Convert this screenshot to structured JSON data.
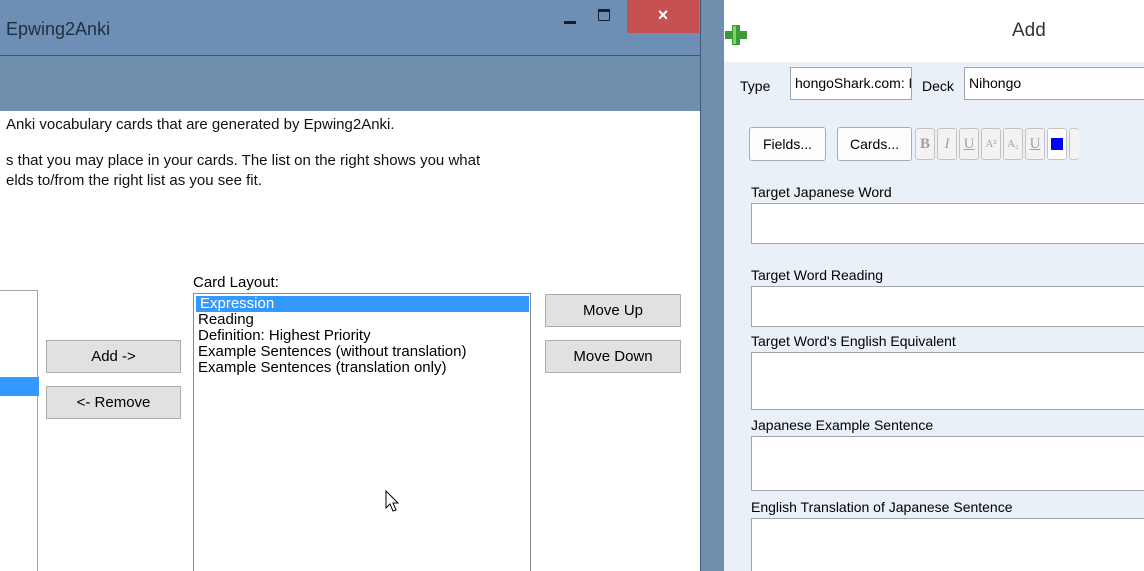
{
  "epwing": {
    "title": "Epwing2Anki",
    "close_glyph": "×",
    "intro_lines": [
      "Anki vocabulary cards that are generated by Epwing2Anki.",
      "s that you may place in your cards. The list on the right shows you what",
      "elds to/from the right list as you see fit."
    ],
    "add_button": "Add ->",
    "remove_button": "<- Remove",
    "card_layout_label": "Card Layout:",
    "card_items": [
      "Expression",
      "Reading",
      "Definition: Highest Priority",
      "Example Sentences (without translation)",
      "Example Sentences (translation only)"
    ],
    "move_up": "Move Up",
    "move_down": "Move Down"
  },
  "anki_add": {
    "title": "Add",
    "type_label": "Type",
    "type_value": "hongoShark.com: My Vocabular",
    "deck_label": "Deck",
    "deck_value": "Nihongo",
    "fields_button": "Fields...",
    "cards_button": "Cards...",
    "format_buttons": [
      "B",
      "I",
      "U",
      "A²",
      "A₂",
      "U"
    ],
    "color_swatch": "#0000ff",
    "fields": [
      "Target Japanese Word",
      "Target Word Reading",
      "Target Word's English Equivalent",
      "Japanese Example Sentence",
      "English Translation of Japanese Sentence"
    ]
  }
}
